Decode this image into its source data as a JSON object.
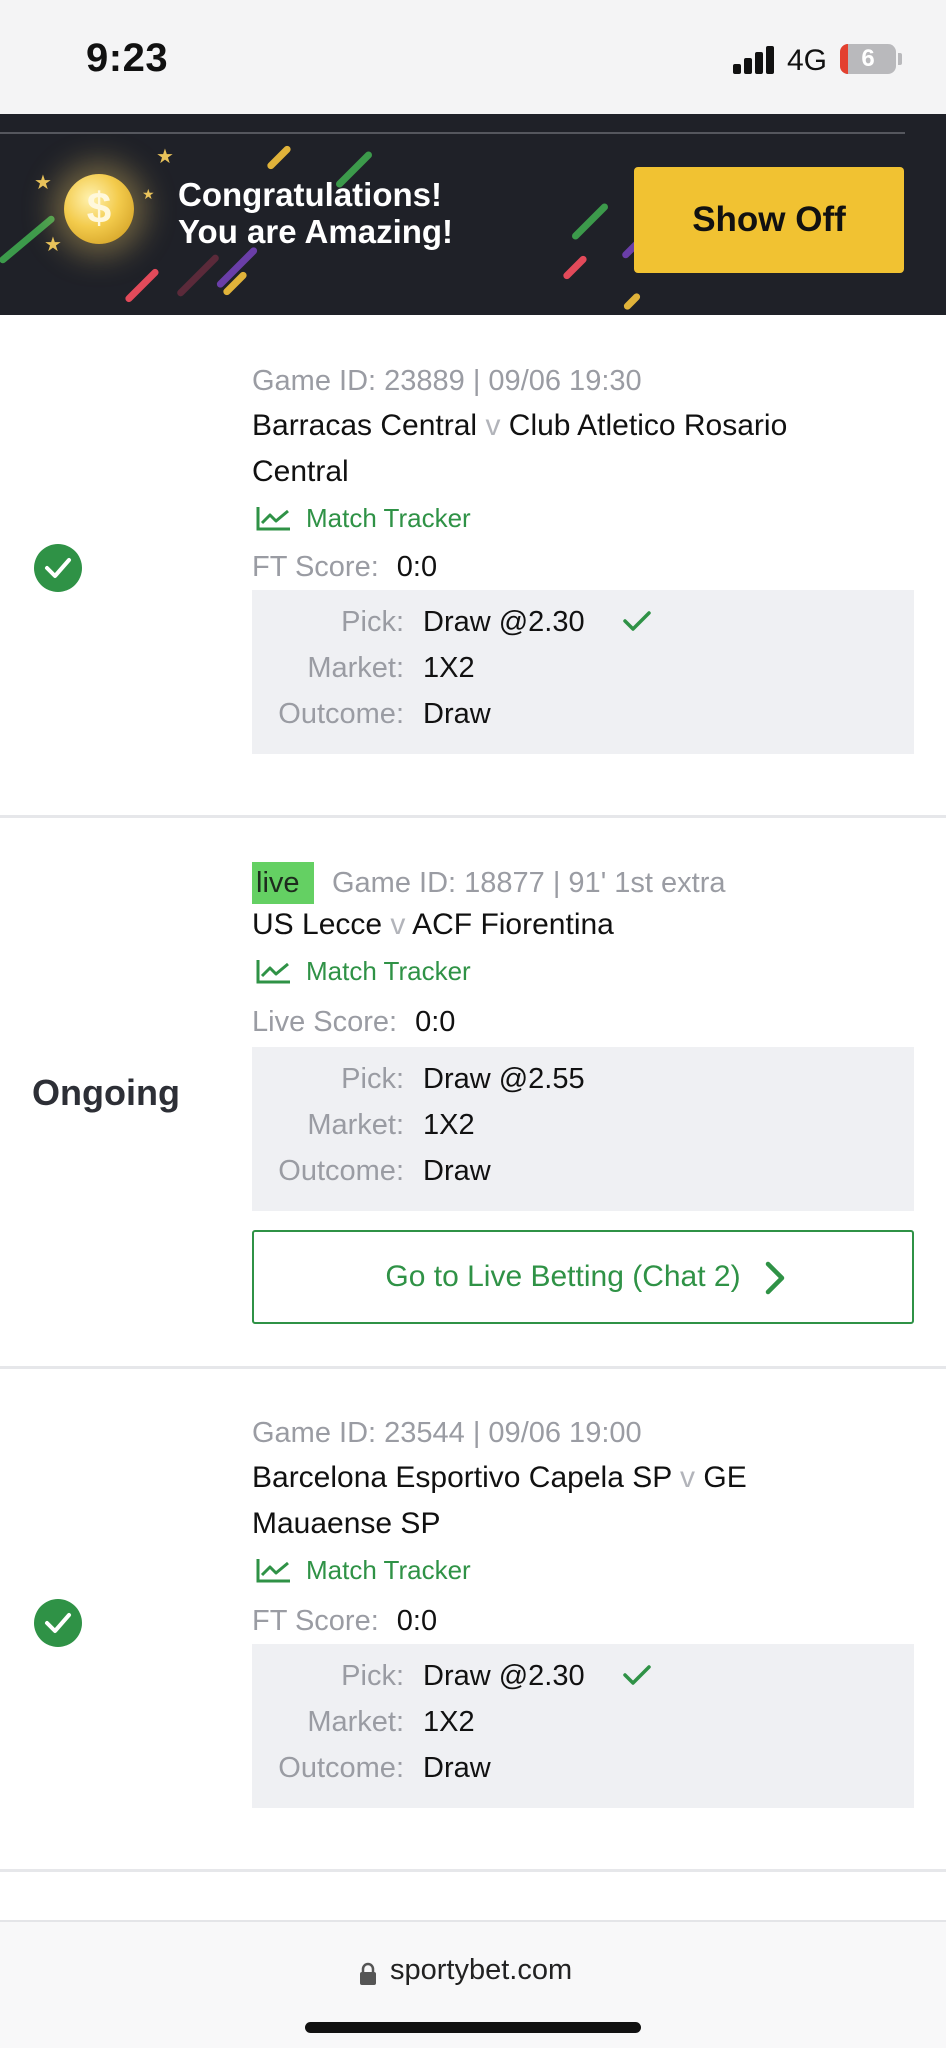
{
  "status_bar": {
    "time": "9:23",
    "network": "4G",
    "battery": "6"
  },
  "banner": {
    "message": "Congratulations! You are Amazing!",
    "button_label": "Show Off",
    "coin_symbol": "$",
    "colors": {
      "background": "#1f2128",
      "button": "#f1c232"
    }
  },
  "bets": [
    {
      "status": "won",
      "game_id": "Game ID: 23889 | 09/06 19:30",
      "home": "Barracas Central",
      "vs": "v",
      "away": "Club Atletico Rosario Central",
      "tracker": "Match Tracker",
      "score_label": "FT Score:",
      "score": "0:0",
      "pick_label": "Pick:",
      "pick": "Draw @2.30",
      "market_label": "Market:",
      "market": "1X2",
      "outcome_label": "Outcome:",
      "outcome": "Draw"
    },
    {
      "status": "Ongoing",
      "live_label": "live",
      "game_id": "Game ID: 18877 | 91' 1st extra",
      "home": "US Lecce",
      "vs": "v",
      "away": "ACF Fiorentina",
      "tracker": "Match Tracker",
      "score_label": "Live Score:",
      "score": "0:0",
      "pick_label": "Pick:",
      "pick": "Draw @2.55",
      "market_label": "Market:",
      "market": "1X2",
      "outcome_label": "Outcome:",
      "outcome": "Draw",
      "live_button": "Go to Live Betting (Chat 2)"
    },
    {
      "status": "won",
      "game_id": "Game ID: 23544 | 09/06 19:00",
      "home": "Barcelona Esportivo Capela SP",
      "vs": "v",
      "away": "GE Mauaense SP",
      "tracker": "Match Tracker",
      "score_label": "FT Score:",
      "score": "0:0",
      "pick_label": "Pick:",
      "pick": "Draw @2.30",
      "market_label": "Market:",
      "market": "1X2",
      "outcome_label": "Outcome:",
      "outcome": "Draw"
    }
  ],
  "browser": {
    "url": "sportybet.com"
  },
  "icons": {
    "status_won": "check-circle-icon",
    "pick_won": "checkmark-icon",
    "tracker": "line-chart-icon",
    "live_button": "chevron-right-icon",
    "url": "lock-icon"
  },
  "colors": {
    "accent_green": "#2f9246",
    "live_badge": "#64d063"
  }
}
